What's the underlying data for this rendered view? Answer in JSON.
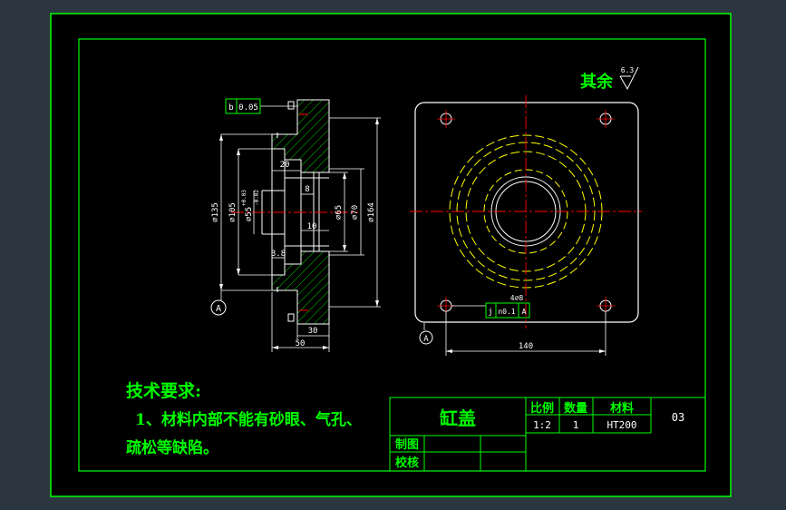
{
  "colors": {
    "viewport": "#2b3640",
    "paper": "#000000",
    "frame": "#00ff00",
    "geometry": "#ffffff",
    "centerline": "#ff0000",
    "hidden": "#ffff00",
    "hatch": "#00ff00",
    "text_tech": "#00ff00"
  },
  "surface_finish": {
    "label": "其余",
    "value": "6.3"
  },
  "tolerances": {
    "left": {
      "symbol": "b",
      "value": "0.05"
    },
    "bottom": {
      "symbol": "j",
      "zone": "n0.1",
      "datum": "A"
    },
    "hole_note": "4⌀8"
  },
  "dimensions": {
    "d135": "⌀135",
    "d105": "⌀105",
    "d55": "⌀55",
    "d55_upper": "+0.03",
    "d55_lower": "-0.02",
    "d65": "⌀65",
    "d70": "⌀70",
    "d164": "⌀164",
    "len20": "20",
    "len8": "8",
    "len10": "10",
    "len3_8": "3.8",
    "len30": "30",
    "len50": "50",
    "len140": "140"
  },
  "datum_left": "A",
  "datum_right": "A",
  "tech": {
    "title": "技术要求:",
    "line1": "1、材料内部不能有砂眼、气孔、",
    "line2": "疏松等缺陷。"
  },
  "title_block": {
    "part_name": "缸盖",
    "col_scale": "比例",
    "col_qty": "数量",
    "col_material": "材料",
    "scale": "1:2",
    "qty": "1",
    "material": "HT200",
    "drawing_no": "03",
    "drawn_by": "制图",
    "checked_by": "校核"
  }
}
